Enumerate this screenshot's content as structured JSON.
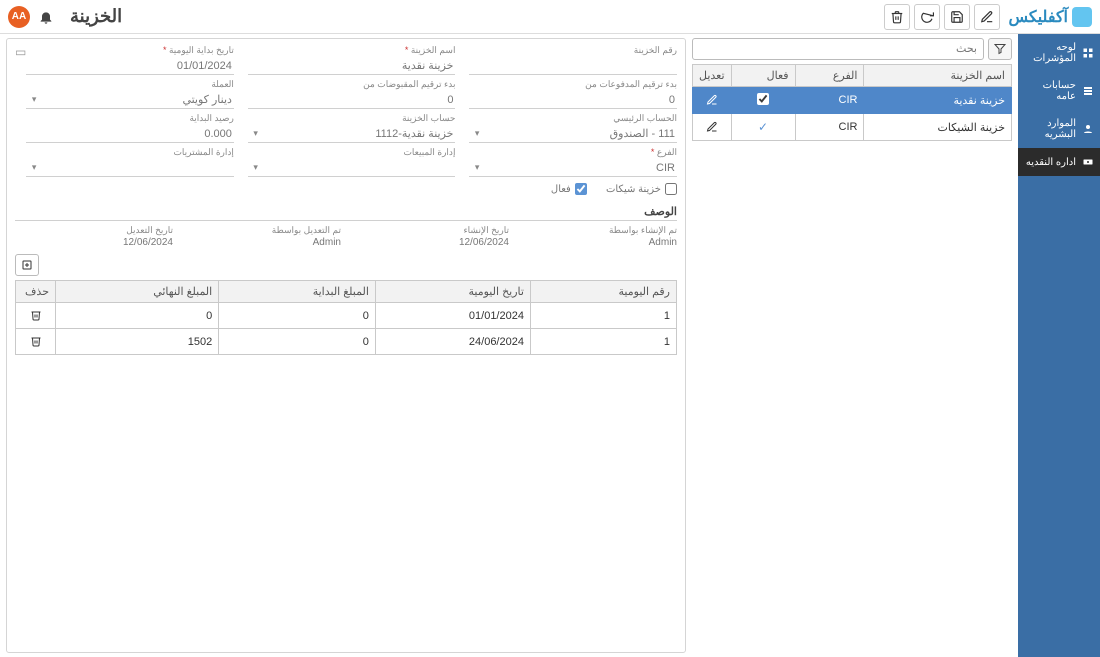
{
  "brand": "آكفليكس",
  "page_title": "الخزينة",
  "avatar_text": "AA",
  "sidebar": {
    "items": [
      {
        "label": "لوحه المؤشرات"
      },
      {
        "label": "حسابات عامه"
      },
      {
        "label": "الموارد البشريه"
      },
      {
        "label": "اداره النقديه"
      }
    ]
  },
  "search": {
    "placeholder": "بحث"
  },
  "list": {
    "columns": {
      "name": "اسم الخزينة",
      "branch": "الفرع",
      "active": "فعال",
      "edit": "تعديل"
    },
    "rows": [
      {
        "name": "خزينة نقدية",
        "branch": "CIR",
        "active": true,
        "selected": true
      },
      {
        "name": "خزينة الشيكات",
        "branch": "CIR",
        "active": true,
        "selected": false
      }
    ]
  },
  "form": {
    "labels": {
      "treasury_no": "رقم الخزينة",
      "treasury_name": "اسم الخزينة",
      "journal_start_date": "تاريخ بداية اليومية",
      "payments_from": "بدء ترقيم المدفوعات من",
      "receipts_from": "بدء ترقيم المقبوضات من",
      "currency": "العملة",
      "main_account": "الحساب الرئيسي",
      "treasury_account": "حساب الخزينة",
      "start_balance": "رصيد البداية",
      "branch": "الفرع",
      "cheque_treasury": "خزينة شيكات",
      "active": "فعال",
      "sales_mgmt": "إدارة المبيعات",
      "purchases_mgmt": "إدارة المشتريات",
      "description": "الوصف"
    },
    "values": {
      "treasury_no": "",
      "treasury_name": "خزينة نقدية",
      "journal_start_date": "01/01/2024",
      "payments_from": "0",
      "receipts_from": "0",
      "currency": "دينار كويتي",
      "main_account": "111 - الصندوق",
      "treasury_account": "خزينة نقدية-1112",
      "start_balance": "0.000",
      "branch": "CIR",
      "cheque_treasury": false,
      "active": true,
      "sales_mgmt": "",
      "purchases_mgmt": ""
    },
    "audit": {
      "created_by_lbl": "تم الإنشاء بواسطة",
      "created_by": "Admin",
      "created_at_lbl": "تاريخ الإنشاء",
      "created_at": "12/06/2024",
      "modified_by_lbl": "تم التعديل بواسطة",
      "modified_by": "Admin",
      "modified_at_lbl": "تاريخ التعديل",
      "modified_at": "12/06/2024"
    }
  },
  "detail": {
    "columns": {
      "journal_no": "رقم اليومية",
      "journal_date": "تاريخ اليومية",
      "start_amount": "المبلغ البداية",
      "end_amount": "المبلغ النهائي",
      "delete": "حذف"
    },
    "rows": [
      {
        "journal_no": "1",
        "journal_date": "01/01/2024",
        "start_amount": "0",
        "end_amount": "0"
      },
      {
        "journal_no": "1",
        "journal_date": "24/06/2024",
        "start_amount": "0",
        "end_amount": "1502"
      }
    ]
  }
}
